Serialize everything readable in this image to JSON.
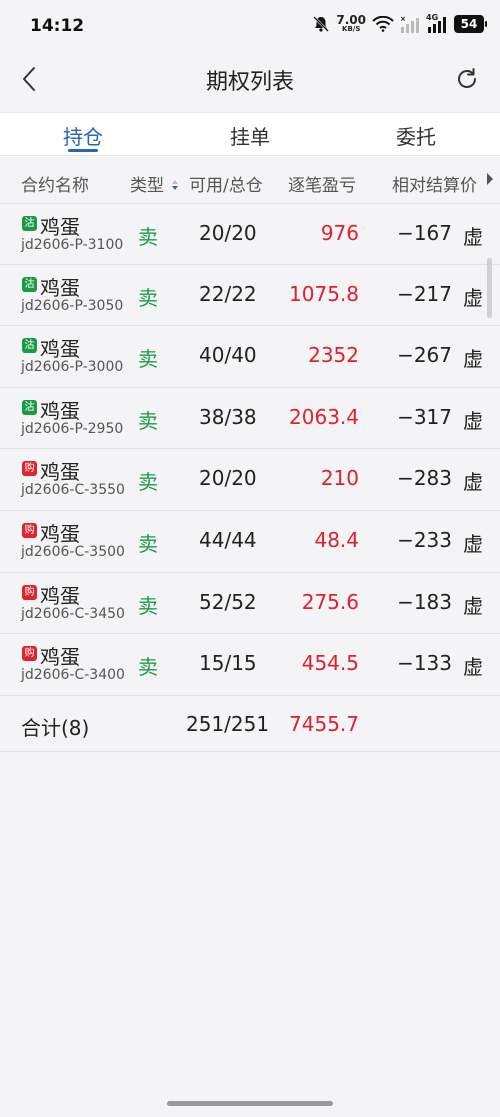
{
  "status_bar": {
    "time": "14:12",
    "net_speed_value": "7.00",
    "net_speed_unit": "KB/S",
    "network_label": "4G",
    "battery": "54"
  },
  "nav": {
    "title": "期权列表"
  },
  "tabs": [
    {
      "label": "持仓",
      "active": true
    },
    {
      "label": "挂单",
      "active": false
    },
    {
      "label": "委托",
      "active": false
    }
  ],
  "columns": {
    "contract": "合约名称",
    "type": "类型",
    "qty": "可用/总仓",
    "pnl": "逐笔盈亏",
    "relative": "相对结算价"
  },
  "rows": [
    {
      "tag": "沽",
      "name": "鸡蛋",
      "code": "jd2606-P-3100",
      "type": "卖",
      "qty": "20/20",
      "pnl": "976",
      "relative": "−167",
      "extra": "虚"
    },
    {
      "tag": "沽",
      "name": "鸡蛋",
      "code": "jd2606-P-3050",
      "type": "卖",
      "qty": "22/22",
      "pnl": "1075.8",
      "relative": "−217",
      "extra": "虚"
    },
    {
      "tag": "沽",
      "name": "鸡蛋",
      "code": "jd2606-P-3000",
      "type": "卖",
      "qty": "40/40",
      "pnl": "2352",
      "relative": "−267",
      "extra": "虚"
    },
    {
      "tag": "沽",
      "name": "鸡蛋",
      "code": "jd2606-P-2950",
      "type": "卖",
      "qty": "38/38",
      "pnl": "2063.4",
      "relative": "−317",
      "extra": "虚"
    },
    {
      "tag": "购",
      "name": "鸡蛋",
      "code": "jd2606-C-3550",
      "type": "卖",
      "qty": "20/20",
      "pnl": "210",
      "relative": "−283",
      "extra": "虚"
    },
    {
      "tag": "购",
      "name": "鸡蛋",
      "code": "jd2606-C-3500",
      "type": "卖",
      "qty": "44/44",
      "pnl": "48.4",
      "relative": "−233",
      "extra": "虚"
    },
    {
      "tag": "购",
      "name": "鸡蛋",
      "code": "jd2606-C-3450",
      "type": "卖",
      "qty": "52/52",
      "pnl": "275.6",
      "relative": "−183",
      "extra": "虚"
    },
    {
      "tag": "购",
      "name": "鸡蛋",
      "code": "jd2606-C-3400",
      "type": "卖",
      "qty": "15/15",
      "pnl": "454.5",
      "relative": "−133",
      "extra": "虚"
    }
  ],
  "total": {
    "label": "合计(8)",
    "qty": "251/251",
    "pnl": "7455.7"
  },
  "colors": {
    "accent": "#2a64b8",
    "loss_gain_red": "#e0202e",
    "sell_green": "#1a9a4a",
    "put_tag": "#1d9a45",
    "call_tag": "#e0242f"
  }
}
